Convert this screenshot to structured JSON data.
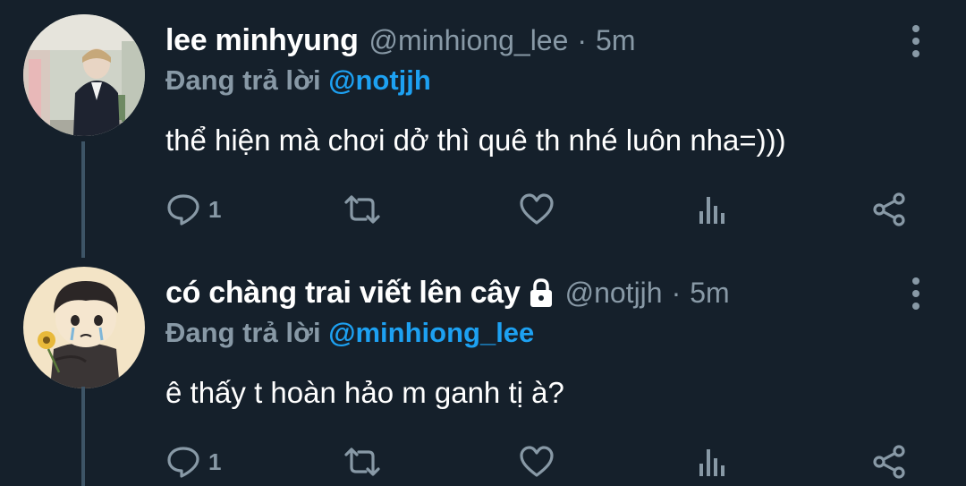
{
  "tweets": [
    {
      "display_name": "lee minhyung",
      "handle": "@minhiong_lee",
      "separator": "·",
      "time": "5m",
      "protected": false,
      "reply_prefix": "Đang trả lời",
      "reply_to": "@notjjh",
      "text": "thể hiện mà chơi dở thì quê th nhé luôn nha=)))",
      "reply_count": "1",
      "avatar_icon": "user-photo-avatar"
    },
    {
      "display_name": "có chàng trai viết lên cây",
      "handle": "@notjjh",
      "separator": "·",
      "time": "5m",
      "protected": true,
      "reply_prefix": "Đang trả lời",
      "reply_to": "@minhiong_lee",
      "text": "ê thấy t hoàn hảo m ganh tị à?",
      "reply_count": "1",
      "avatar_icon": "cartoon-crying-boy-avatar"
    }
  ],
  "colors": {
    "background": "#15202b",
    "secondary_text": "#8899a6",
    "mention": "#1da1f2",
    "thread_line": "#3d5466"
  },
  "icons": [
    "reply-icon",
    "retweet-icon",
    "like-icon",
    "analytics-icon",
    "share-icon",
    "more-icon",
    "lock-icon"
  ]
}
